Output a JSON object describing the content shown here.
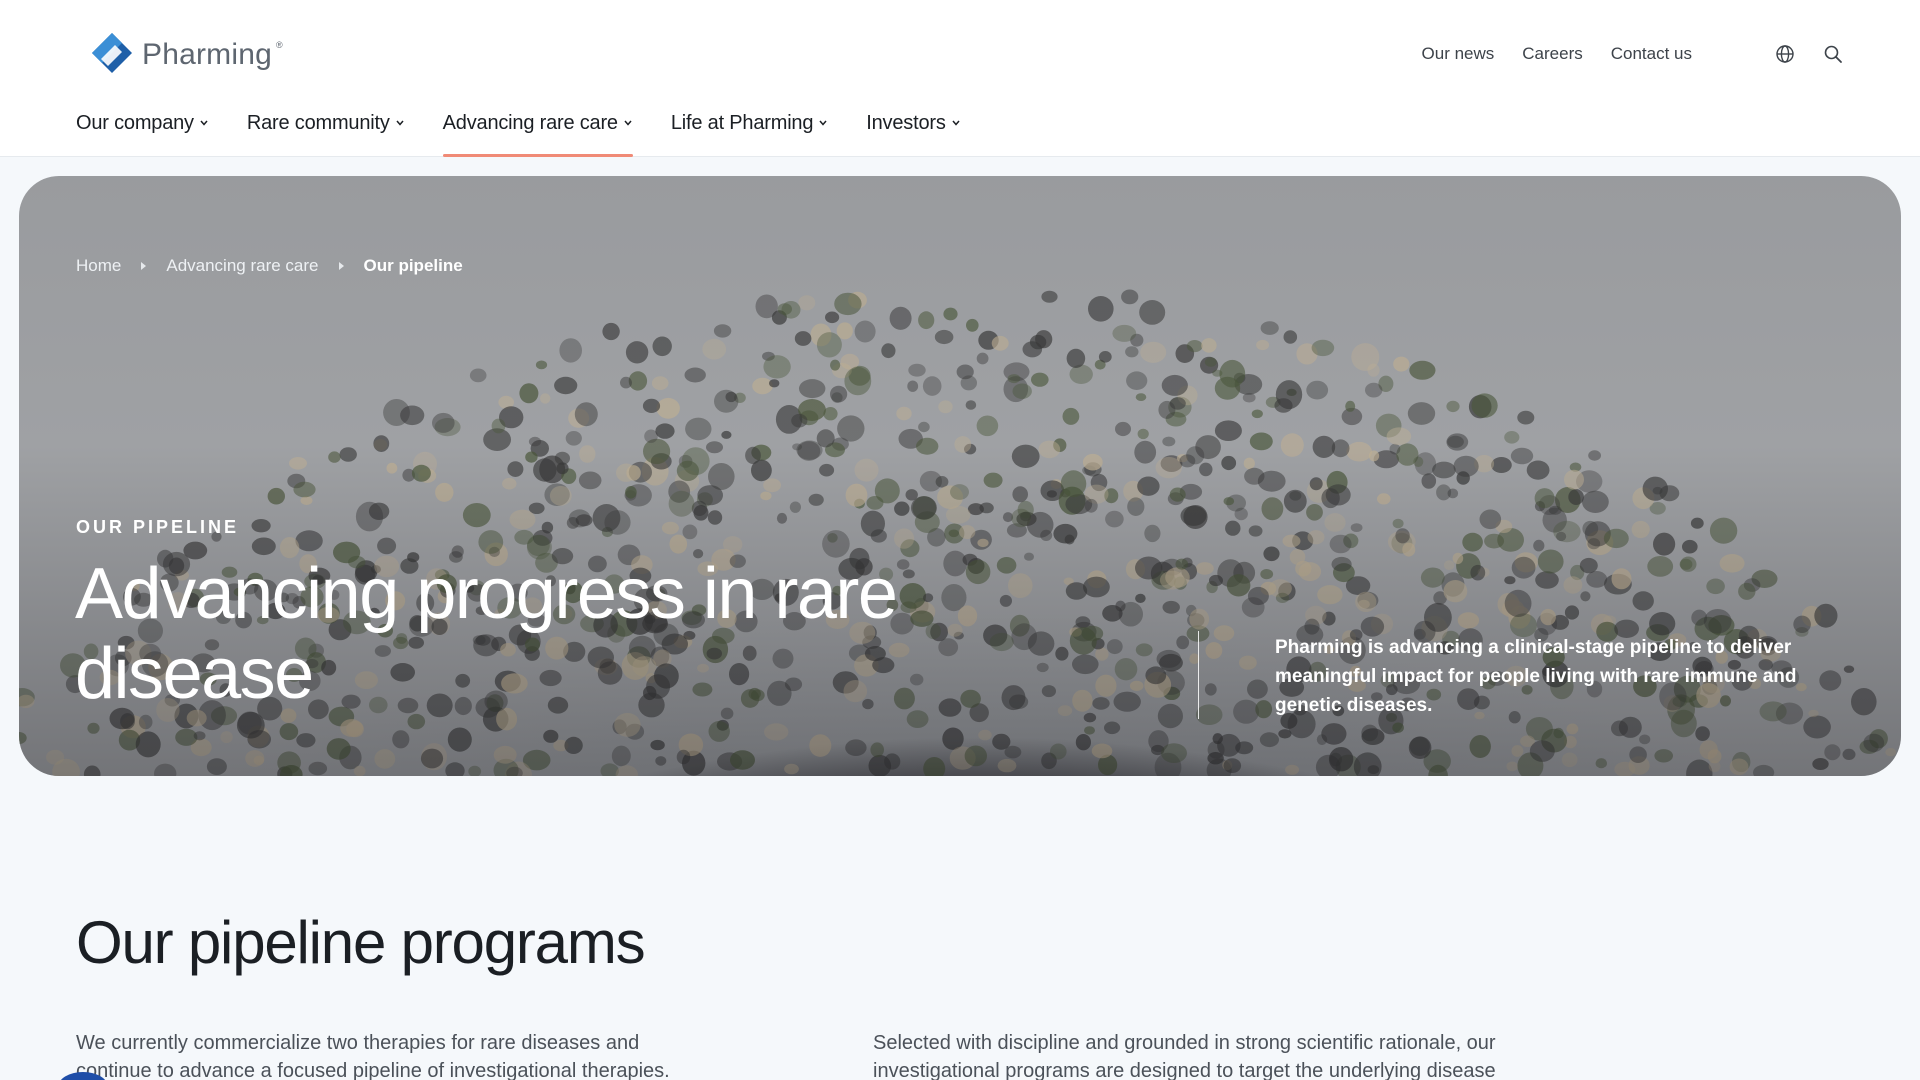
{
  "brand": {
    "name": "Pharming",
    "registered": "®",
    "colors": {
      "logo_dark": "#1e5fa8",
      "logo_light": "#3b8fd6",
      "accent": "#f08a76"
    }
  },
  "utility_nav": {
    "items": [
      "Our news",
      "Careers",
      "Contact us"
    ],
    "icons": [
      "globe-icon",
      "search-icon"
    ]
  },
  "main_nav": {
    "items": [
      {
        "label": "Our company",
        "active": false
      },
      {
        "label": "Rare community",
        "active": false
      },
      {
        "label": "Advancing rare care",
        "active": true
      },
      {
        "label": "Life at Pharming",
        "active": false
      },
      {
        "label": "Investors",
        "active": false
      }
    ]
  },
  "breadcrumb": {
    "items": [
      "Home",
      "Advancing rare care",
      "Our pipeline"
    ]
  },
  "hero": {
    "eyebrow": "OUR PIPELINE",
    "title": "Advancing progress in rare disease",
    "description": "Pharming is advancing a clinical-stage pipeline to deliver meaningful impact for people living with rare immune and genetic diseases."
  },
  "section": {
    "title": "Our pipeline programs",
    "left_text": "We currently commercialize two therapies for rare diseases and continue to advance a focused pipeline of investigational therapies.",
    "right_text": "Selected with discipline and grounded in strong scientific rationale, our investigational programs are designed to target the underlying disease"
  }
}
